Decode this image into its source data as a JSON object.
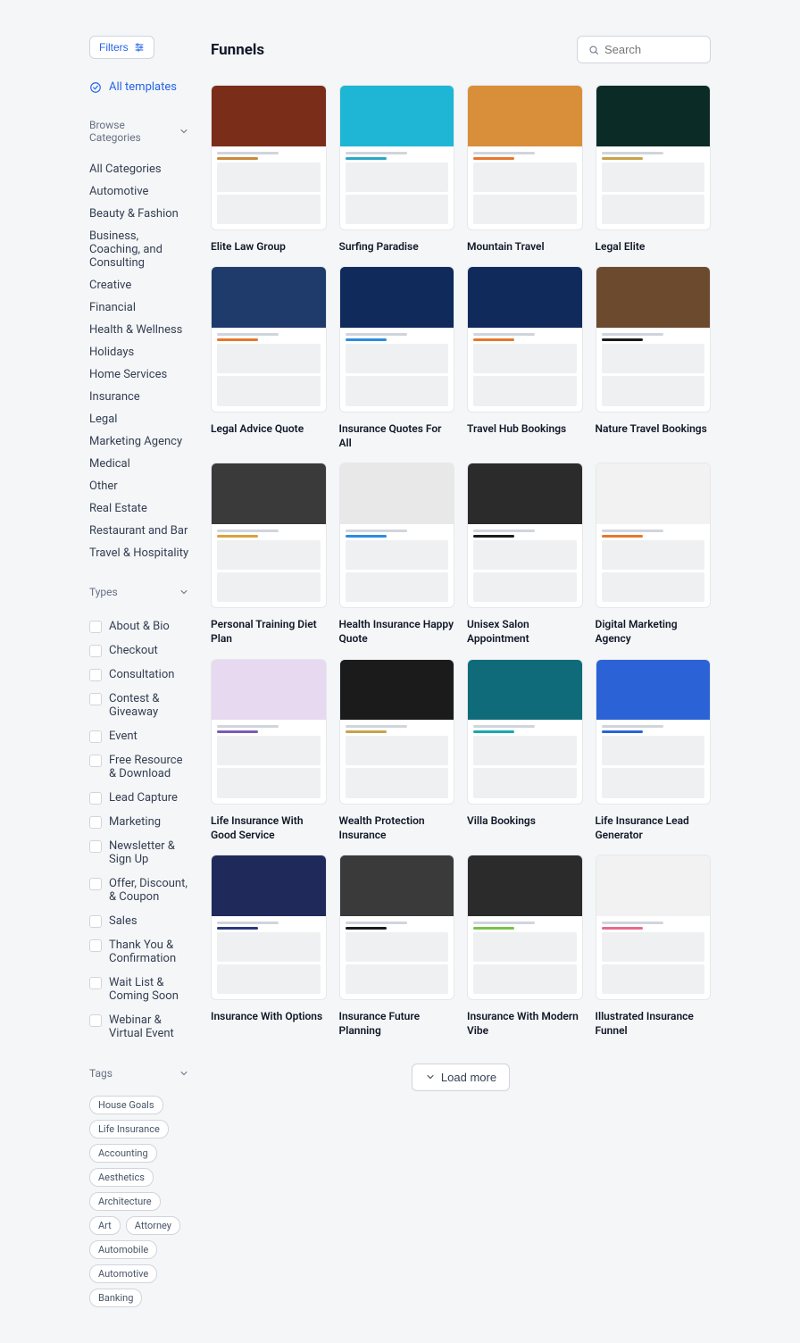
{
  "title": "Funnels",
  "search": {
    "placeholder": "Search"
  },
  "filters_label": "Filters",
  "all_templates_label": "All templates",
  "sidebar": {
    "browse_header": "Browse Categories",
    "types_header": "Types",
    "tags_header": "Tags",
    "categories": [
      "All Categories",
      "Automotive",
      "Beauty & Fashion",
      "Business, Coaching, and Consulting",
      "Creative",
      "Financial",
      "Health & Wellness",
      "Holidays",
      "Home Services",
      "Insurance",
      "Legal",
      "Marketing Agency",
      "Medical",
      "Other",
      "Real Estate",
      "Restaurant and Bar",
      "Travel & Hospitality"
    ],
    "types": [
      "About & Bio",
      "Checkout",
      "Consultation",
      "Contest & Giveaway",
      "Event",
      "Free Resource & Download",
      "Lead Capture",
      "Marketing",
      "Newsletter & Sign Up",
      "Offer, Discount, & Coupon",
      "Sales",
      "Thank You & Confirmation",
      "Wait List & Coming Soon",
      "Webinar & Virtual Event"
    ],
    "tags": [
      "House Goals",
      "Life Insurance",
      "Accounting",
      "Aesthetics",
      "Architecture",
      "Art",
      "Attorney",
      "Automobile",
      "Automotive",
      "Banking"
    ]
  },
  "load_more_label": "Load more",
  "funnels": [
    {
      "title": "Elite Law Group",
      "hero": "#7a2e1a",
      "accent": "#c98a3a"
    },
    {
      "title": "Surfing Paradise",
      "hero": "#1fb6d6",
      "accent": "#2aa7c4"
    },
    {
      "title": "Mountain Travel",
      "hero": "#d98e3a",
      "accent": "#e8762c"
    },
    {
      "title": "Legal Elite",
      "hero": "#0b2b27",
      "accent": "#c8a24a"
    },
    {
      "title": "Legal Advice Quote",
      "hero": "#1f3b6b",
      "accent": "#e8762c"
    },
    {
      "title": "Insurance Quotes For All",
      "hero": "#0f2a5b",
      "accent": "#2b8ce0"
    },
    {
      "title": "Travel Hub Bookings",
      "hero": "#0f2a5b",
      "accent": "#e8762c"
    },
    {
      "title": "Nature Travel Bookings",
      "hero": "#6b4a2e",
      "accent": "#1b1b1b"
    },
    {
      "title": "Personal Training Diet Plan",
      "hero": "#3a3a3a",
      "accent": "#d9a23a"
    },
    {
      "title": "Health Insurance Happy Quote",
      "hero": "#e8e8e8",
      "accent": "#2b8ce0"
    },
    {
      "title": "Unisex Salon Appointment",
      "hero": "#2b2b2b",
      "accent": "#1b1b1b"
    },
    {
      "title": "Digital Marketing Agency",
      "hero": "#f2f2f2",
      "accent": "#e8762c"
    },
    {
      "title": "Life Insurance With Good Service",
      "hero": "#e6d9f0",
      "accent": "#7b5bb5"
    },
    {
      "title": "Wealth Protection Insurance",
      "hero": "#1b1b1b",
      "accent": "#c8a24a"
    },
    {
      "title": "Villa Bookings",
      "hero": "#0f6b7a",
      "accent": "#18a7ae"
    },
    {
      "title": "Life Insurance Lead Generator",
      "hero": "#2b63d6",
      "accent": "#2b63d6"
    },
    {
      "title": "Insurance With Options",
      "hero": "#1f2a5b",
      "accent": "#2b3a7a"
    },
    {
      "title": "Insurance Future Planning",
      "hero": "#3a3a3a",
      "accent": "#1b1b1b"
    },
    {
      "title": "Insurance With Modern Vibe",
      "hero": "#2b2b2b",
      "accent": "#7ac14a"
    },
    {
      "title": "Illustrated Insurance Funnel",
      "hero": "#f2f2f2",
      "accent": "#e86a8a"
    }
  ]
}
